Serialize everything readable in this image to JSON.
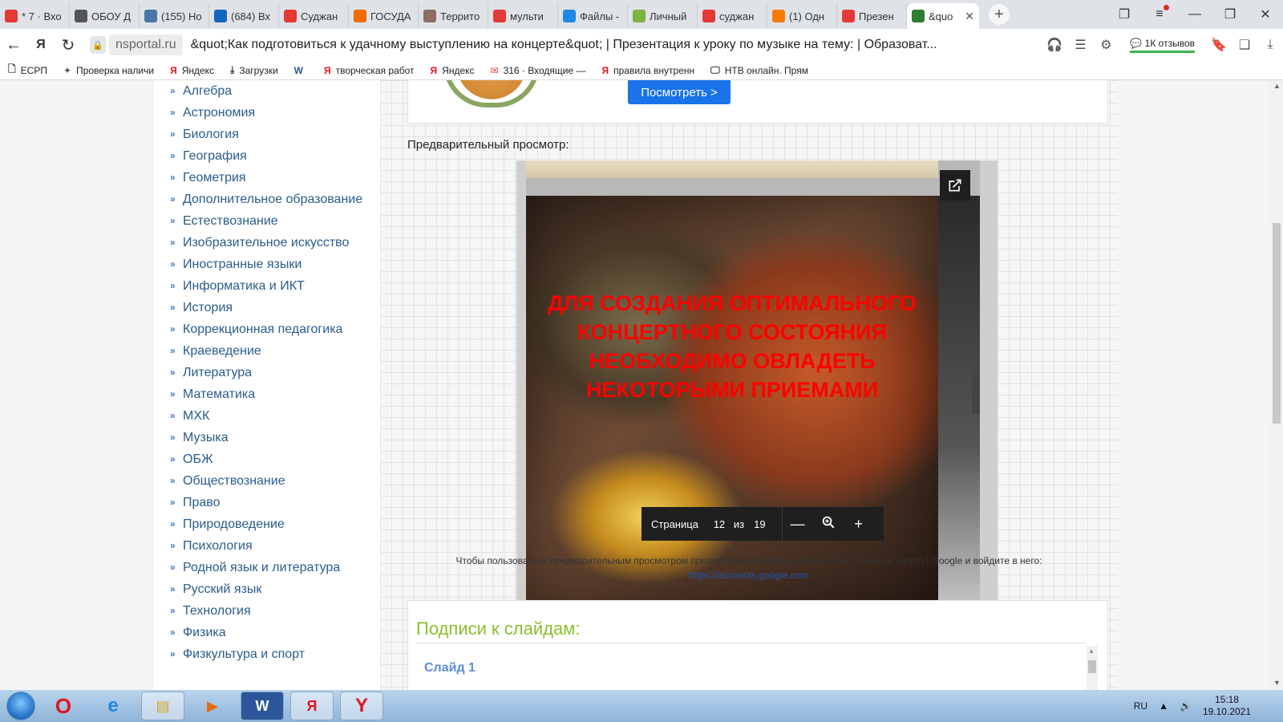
{
  "browser": {
    "tabs": [
      {
        "title": "* 7 · Вхо",
        "icon": "mail-icon",
        "color": "#e53935"
      },
      {
        "title": "ОБОУ Д",
        "icon": "document-icon",
        "color": "#555555"
      },
      {
        "title": "(155) Но",
        "icon": "vk-icon",
        "color": "#4a76a8"
      },
      {
        "title": "(684) Вх",
        "icon": "envelope-icon",
        "color": "#1565c0"
      },
      {
        "title": "Суджан",
        "icon": "yandex-icon",
        "color": "#e53935"
      },
      {
        "title": "ГОСУДА",
        "icon": "flame-icon",
        "color": "#ef6c00"
      },
      {
        "title": "Террито",
        "icon": "emblem-icon",
        "color": "#8d6e63"
      },
      {
        "title": "мульти",
        "icon": "yandex-icon",
        "color": "#e53935"
      },
      {
        "title": "Файлы -",
        "icon": "folder-icon",
        "color": "#1e88e5"
      },
      {
        "title": "Личный",
        "icon": "portal-icon",
        "color": "#7cb342"
      },
      {
        "title": "суджан",
        "icon": "yandex-icon",
        "color": "#e53935"
      },
      {
        "title": "(1) Одн",
        "icon": "ok-icon",
        "color": "#f57c00"
      },
      {
        "title": "Презен",
        "icon": "yandex-icon",
        "color": "#e53935"
      },
      {
        "title": "&quo",
        "icon": "checkmark-icon",
        "color": "#2e7d32"
      }
    ],
    "address": {
      "domain": "nsportal.ru",
      "title": "&quot;Как подготовиться к удачному выступлению на концерте&quot; | Презентация к уроку по музыке на тему: | Образоват..."
    },
    "reviews": "1К отзывов",
    "bookmarks": [
      {
        "label": "ЕСРП",
        "icon": "page-icon"
      },
      {
        "label": "Проверка наличи",
        "icon": "eagle-icon"
      },
      {
        "label": "Яндекс",
        "icon": "yandex-icon"
      },
      {
        "label": "Загрузки",
        "icon": "download-icon"
      },
      {
        "label": "",
        "icon": "word-icon"
      },
      {
        "label": "творческая работ",
        "icon": "yandex-icon"
      },
      {
        "label": "Яндекс",
        "icon": "yandex-icon"
      },
      {
        "label": "316 · Входящие —",
        "icon": "mail-icon"
      },
      {
        "label": "правила внутренн",
        "icon": "yandex-icon"
      },
      {
        "label": "НТВ онлайн. Прям",
        "icon": "monitor-icon"
      }
    ]
  },
  "sidebar": {
    "items": [
      "Алгебра",
      "Астрономия",
      "Биология",
      "География",
      "Геометрия",
      "Дополнительное образование",
      "Естествознание",
      "Изобразительное искусство",
      "Иностранные языки",
      "Информатика и ИКТ",
      "История",
      "Коррекционная педагогика",
      "Краеведение",
      "Литература",
      "Математика",
      "МХК",
      "Музыка",
      "ОБЖ",
      "Обществознание",
      "Право",
      "Природоведение",
      "Психология",
      "Родной язык и литература",
      "Русский язык",
      "Технология",
      "Физика",
      "Физкультура и спорт"
    ]
  },
  "main": {
    "view_button": "Посмотреть >",
    "preview_label": "Предварительный просмотр:",
    "slide_text": "ДЛЯ СОЗДАНИЯ ОПТИМАЛЬНОГО КОНЦЕРТНОГО СОСТОЯНИЯ НЕОБХОДИМО ОВЛАДЕТЬ НЕКОТОРЫМИ ПРИЕМАМИ",
    "pager": {
      "label": "Страница",
      "current": "12",
      "of": "из",
      "total": "19"
    },
    "note": "Чтобы пользоваться предварительным просмотром презентаций создайте себе аккаунт (учетную запись) Google и войдите в него:",
    "note_link": "https://accounts.google.com",
    "captions_title": "Подписи к слайдам:",
    "slide1": "Слайд 1"
  },
  "taskbar": {
    "lang": "RU",
    "time": "15:18",
    "date": "19.10.2021"
  }
}
